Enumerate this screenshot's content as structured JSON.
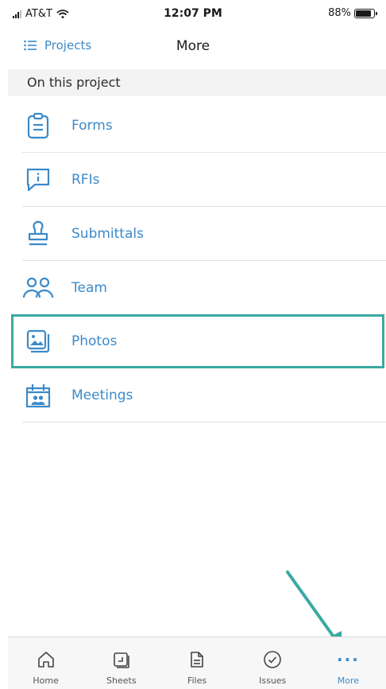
{
  "status_bar": {
    "carrier": "AT&T",
    "time": "12:07 PM",
    "battery": "88%",
    "battery_level": 0.88
  },
  "nav": {
    "back_label": "Projects",
    "title": "More"
  },
  "section": {
    "title": "On this project"
  },
  "menu_items": [
    {
      "label": "Forms",
      "icon": "clipboard-icon"
    },
    {
      "label": "RFIs",
      "icon": "info-chat-icon"
    },
    {
      "label": "Submittals",
      "icon": "stamp-icon"
    },
    {
      "label": "Team",
      "icon": "people-icon"
    },
    {
      "label": "Photos",
      "icon": "photos-icon",
      "highlighted": true
    },
    {
      "label": "Meetings",
      "icon": "calendar-people-icon"
    }
  ],
  "tabs": [
    {
      "label": "Home",
      "icon": "home-icon"
    },
    {
      "label": "Sheets",
      "icon": "sheets-icon"
    },
    {
      "label": "Files",
      "icon": "file-icon"
    },
    {
      "label": "Issues",
      "icon": "check-circle-icon"
    },
    {
      "label": "More",
      "icon": "more-dots-icon",
      "active": true
    }
  ],
  "colors": {
    "accent": "#3c8ac9",
    "highlight": "#3aa9a3",
    "annotation_arrow": "#3aa9a3"
  }
}
